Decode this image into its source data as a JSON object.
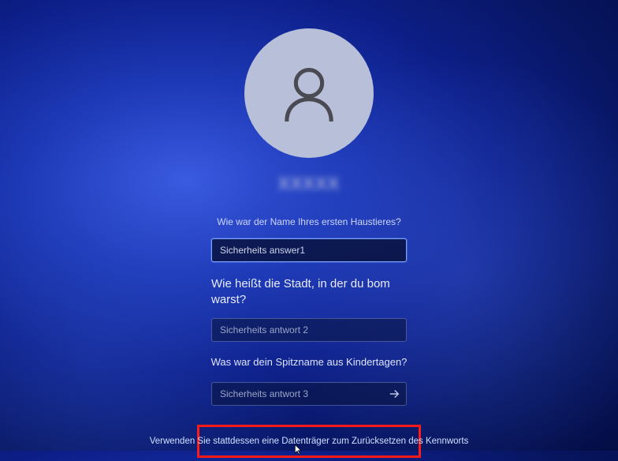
{
  "username": "XXXXX",
  "questions": {
    "q1": "Wie war der Name Ihres ersten Haustieres?",
    "q2": "Wie heißt die Stadt, in der du bom warst?",
    "q3": "Was war dein Spitzname aus Kindertagen?"
  },
  "inputs": {
    "a1_value": "Sicherheits answer1",
    "a2_placeholder": "Sicherheits antwort 2",
    "a3_placeholder": "Sicherheits antwort 3"
  },
  "reset_link": "Verwenden Sie stattdessen eine Datenträger zum Zurücksetzen des Kennworts"
}
